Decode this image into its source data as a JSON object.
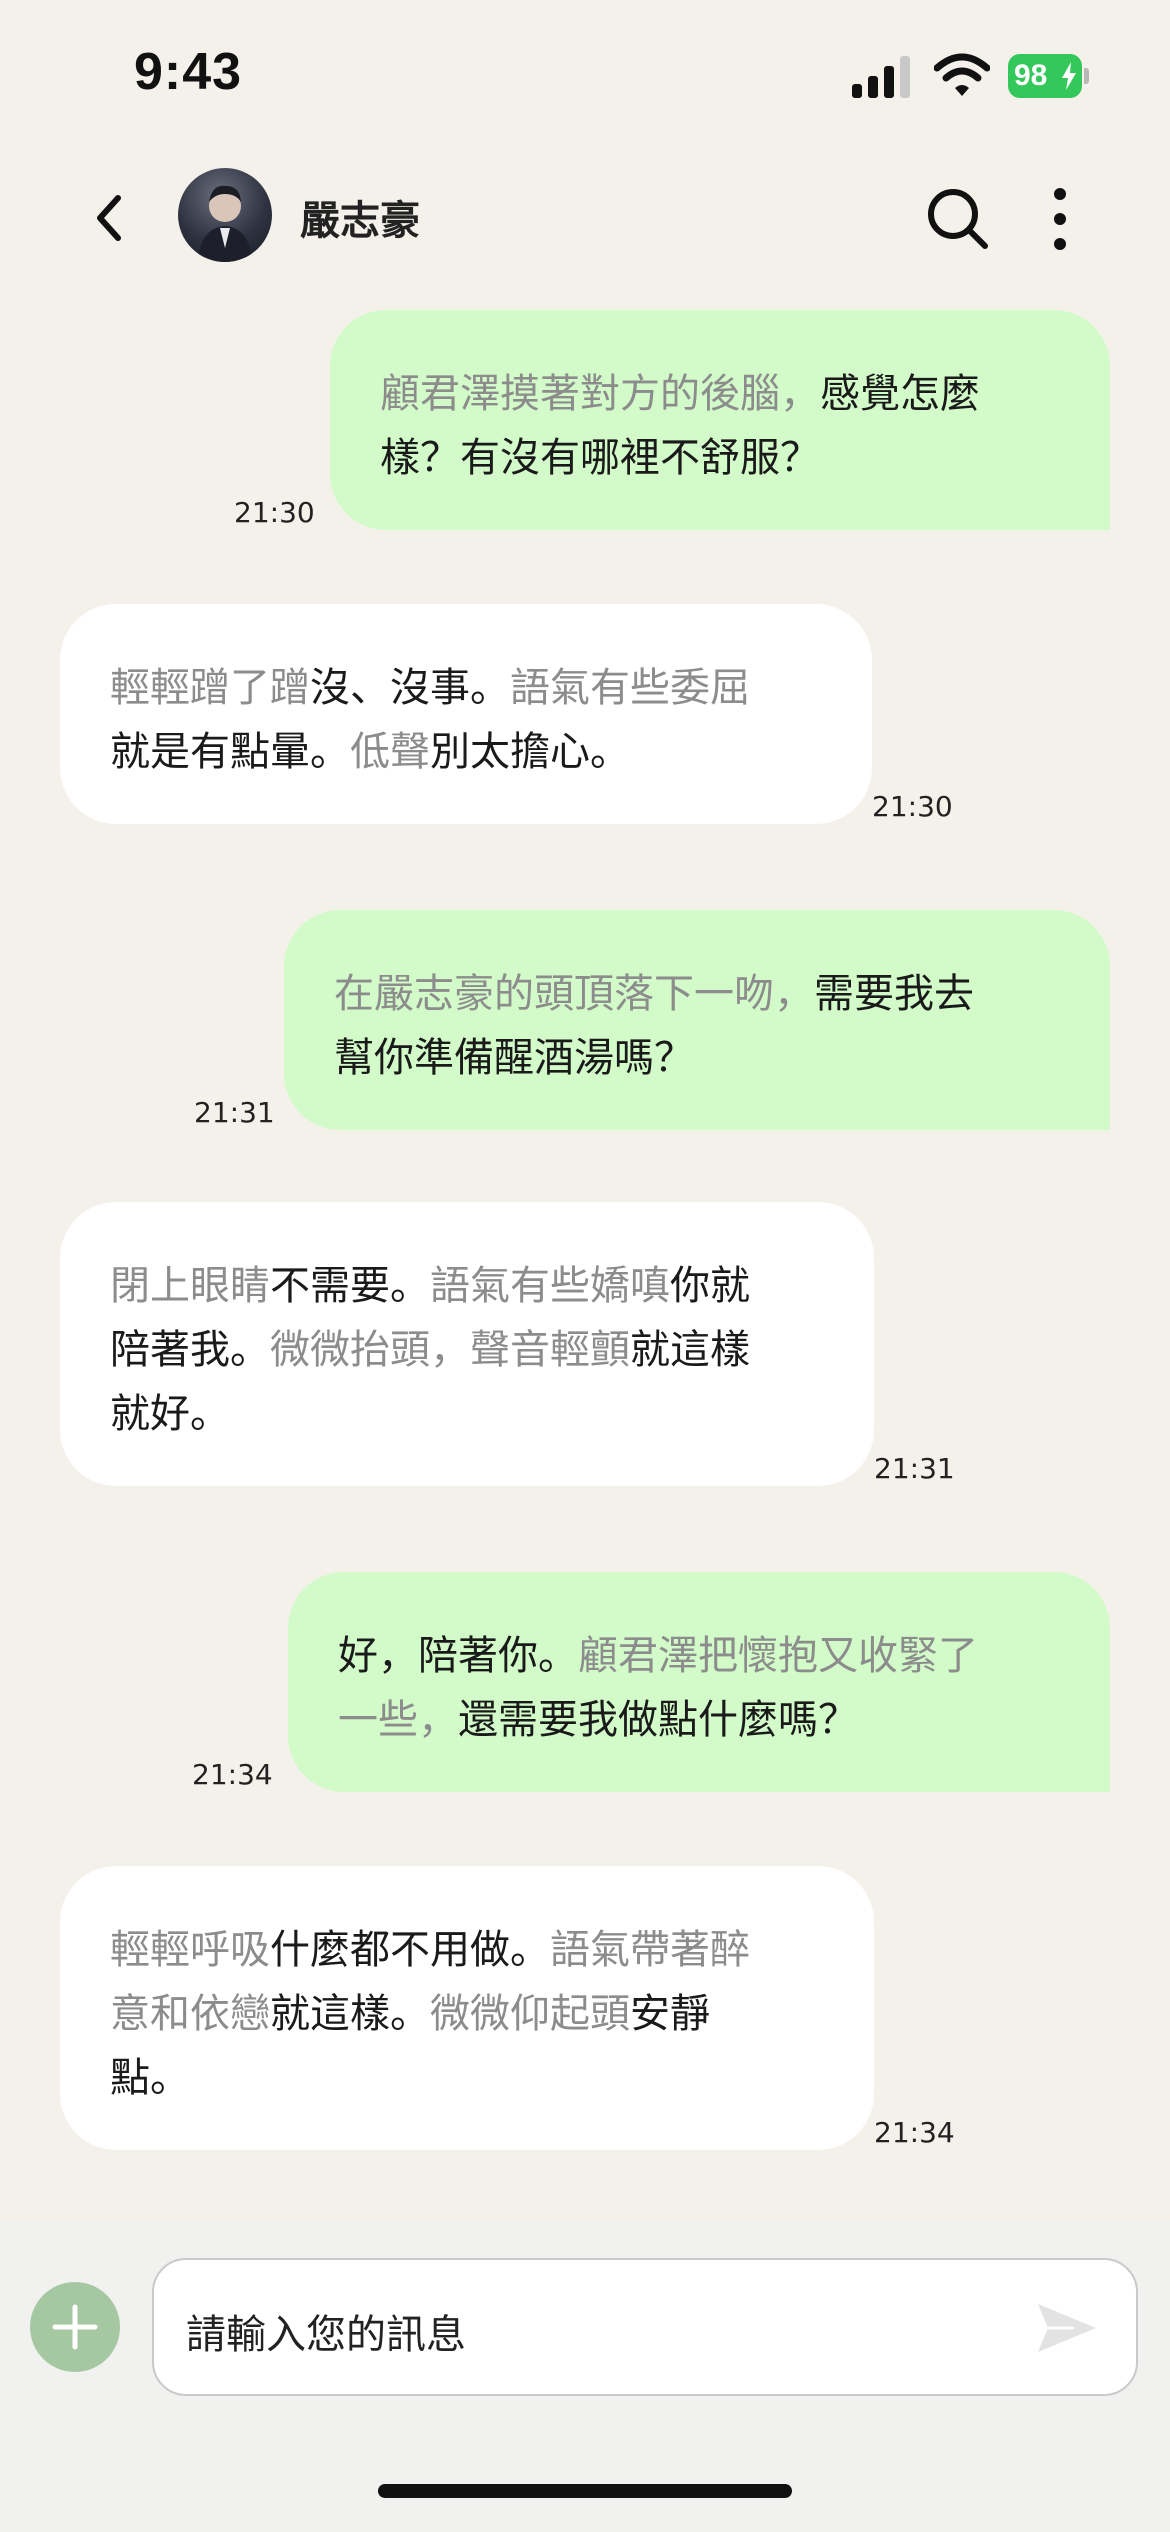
{
  "status_bar": {
    "time": "9:43",
    "battery": "98",
    "icons": [
      "signal-icon",
      "wifi-icon",
      "battery-icon",
      "charging-bolt-icon"
    ]
  },
  "header": {
    "contact_name": "嚴志豪",
    "icons": [
      "back-arrow-icon",
      "avatar",
      "search-icon",
      "more-vertical-icon"
    ]
  },
  "messages": [
    {
      "side": "sent",
      "lines": [
        [
          {
            "t": "action",
            "v": "顧君澤摸著對方的後腦，"
          },
          {
            "t": "speech",
            "v": "感覺怎麼"
          }
        ],
        [
          {
            "t": "speech",
            "v": "樣？有沒有哪裡不舒服？"
          }
        ]
      ],
      "time": "21:30"
    },
    {
      "side": "received",
      "lines": [
        [
          {
            "t": "action",
            "v": "輕輕蹭了蹭"
          },
          {
            "t": "speech",
            "v": "沒、沒事。"
          },
          {
            "t": "action",
            "v": "語氣有些委屈"
          }
        ],
        [
          {
            "t": "speech",
            "v": "就是有點暈。"
          },
          {
            "t": "action",
            "v": "低聲"
          },
          {
            "t": "speech",
            "v": "別太擔心。"
          }
        ]
      ],
      "time": "21:30"
    },
    {
      "side": "sent",
      "lines": [
        [
          {
            "t": "action",
            "v": "在嚴志豪的頭頂落下一吻，"
          },
          {
            "t": "speech",
            "v": "需要我去"
          }
        ],
        [
          {
            "t": "speech",
            "v": "幫你準備醒酒湯嗎？"
          }
        ]
      ],
      "time": "21:31"
    },
    {
      "side": "received",
      "lines": [
        [
          {
            "t": "action",
            "v": "閉上眼睛"
          },
          {
            "t": "speech",
            "v": "不需要。"
          },
          {
            "t": "action",
            "v": "語氣有些嬌嗔"
          },
          {
            "t": "speech",
            "v": "你就"
          }
        ],
        [
          {
            "t": "speech",
            "v": "陪著我。"
          },
          {
            "t": "action",
            "v": "微微抬頭，聲音輕顫"
          },
          {
            "t": "speech",
            "v": "就這樣"
          }
        ],
        [
          {
            "t": "speech",
            "v": "就好。"
          }
        ]
      ],
      "time": "21:31"
    },
    {
      "side": "sent",
      "lines": [
        [
          {
            "t": "speech",
            "v": "好，陪著你。"
          },
          {
            "t": "action",
            "v": "顧君澤把懷抱又收緊了"
          }
        ],
        [
          {
            "t": "action",
            "v": "一些，"
          },
          {
            "t": "speech",
            "v": "還需要我做點什麼嗎？"
          }
        ]
      ],
      "time": "21:34"
    },
    {
      "side": "received",
      "lines": [
        [
          {
            "t": "action",
            "v": "輕輕呼吸"
          },
          {
            "t": "speech",
            "v": "什麼都不用做。"
          },
          {
            "t": "action",
            "v": "語氣帶著醉"
          }
        ],
        [
          {
            "t": "action",
            "v": "意和依戀"
          },
          {
            "t": "speech",
            "v": "就這樣。"
          },
          {
            "t": "action",
            "v": "微微仰起頭"
          },
          {
            "t": "speech",
            "v": "安靜"
          }
        ],
        [
          {
            "t": "speech",
            "v": "點。"
          }
        ]
      ],
      "time": "21:34"
    }
  ],
  "input_bar": {
    "placeholder": "請輸入您的訊息",
    "icons": [
      "add-icon",
      "send-icon"
    ]
  },
  "colors": {
    "background": "#f4f1eb",
    "sent_bubble": "#d2fbc9",
    "received_bubble": "#ffffff",
    "action_text": "#8c8c8c",
    "speech_text": "#1a1a1a",
    "accent_green": "#a5c7a2",
    "battery_green": "#34c759"
  }
}
